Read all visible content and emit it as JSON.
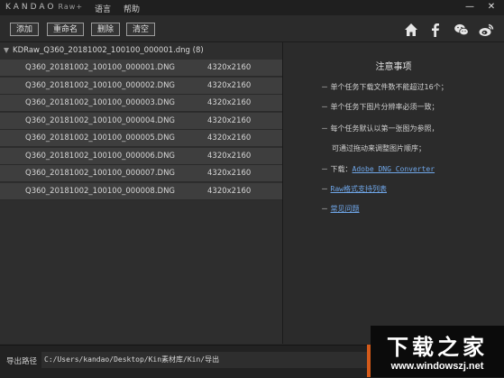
{
  "titlebar": {
    "brand": "KANDAO",
    "brand_sub": "Raw+",
    "menu": [
      "语言",
      "帮助"
    ],
    "controls": {
      "minimize": "—",
      "close": "✕"
    }
  },
  "toolbar": {
    "buttons": [
      "添加",
      "重命名",
      "删除",
      "清空"
    ],
    "social_icons": [
      "home-icon",
      "facebook-icon",
      "wechat-icon",
      "weibo-icon"
    ]
  },
  "file_list": {
    "folder_label": "KDRaw_Q360_20181002_100100_000001.dng",
    "folder_count": "(8)",
    "rows": [
      {
        "name": "Q360_20181002_100100_000001.DNG",
        "res": "4320x2160"
      },
      {
        "name": "Q360_20181002_100100_000002.DNG",
        "res": "4320x2160"
      },
      {
        "name": "Q360_20181002_100100_000003.DNG",
        "res": "4320x2160"
      },
      {
        "name": "Q360_20181002_100100_000004.DNG",
        "res": "4320x2160"
      },
      {
        "name": "Q360_20181002_100100_000005.DNG",
        "res": "4320x2160"
      },
      {
        "name": "Q360_20181002_100100_000006.DNG",
        "res": "4320x2160"
      },
      {
        "name": "Q360_20181002_100100_000007.DNG",
        "res": "4320x2160"
      },
      {
        "name": "Q360_20181002_100100_000008.DNG",
        "res": "4320x2160"
      }
    ]
  },
  "notice": {
    "title": "注意事项",
    "line1": "－ 单个任务下载文件数不能超过16个；",
    "line2": "－ 单个任务下图片分辨率必须一致；",
    "line3": "－ 每个任务默认以第一张图为参照，",
    "line3b": "可通过拖动来调整图片顺序；",
    "download_prefix": "－ 下载：",
    "download_link": "Adobe DNG Converter",
    "raw_link": "Raw格式支持列表",
    "faq_link": "常见问题",
    "link_dash": "－"
  },
  "export": {
    "label": "导出路径",
    "path": "C:/Users/kandao/Desktop/Kin素材库/Kin/导出"
  },
  "watermark": {
    "main": "下载之家",
    "url": "www.windowszj.net"
  },
  "colors": {
    "background": "#2b2b2b",
    "row": "#3e3e3e",
    "link": "#6fa6e8",
    "watermark_accent": "#d45a1a"
  }
}
